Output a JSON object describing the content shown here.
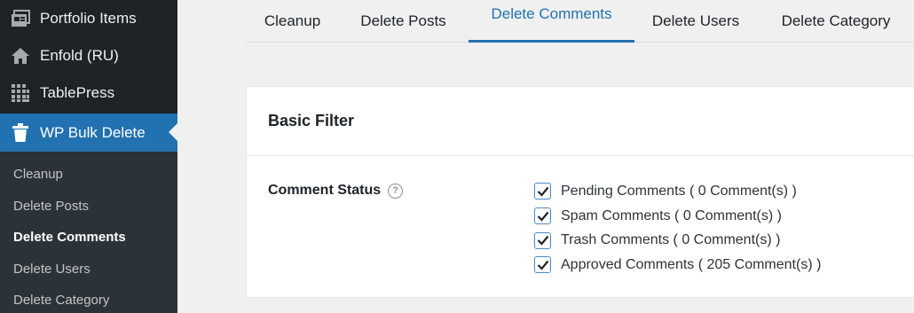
{
  "sidebar": {
    "menu": [
      {
        "label": "Portfolio Items",
        "icon": "portfolio-icon"
      },
      {
        "label": "Enfold (RU)",
        "icon": "home-icon"
      },
      {
        "label": "TablePress",
        "icon": "table-icon"
      },
      {
        "label": "WP Bulk Delete",
        "icon": "trash-icon",
        "current": true
      }
    ],
    "submenu": [
      {
        "label": "Cleanup"
      },
      {
        "label": "Delete Posts"
      },
      {
        "label": "Delete Comments",
        "active": true
      },
      {
        "label": "Delete Users"
      },
      {
        "label": "Delete Category"
      }
    ]
  },
  "tabs": [
    {
      "label": "Cleanup"
    },
    {
      "label": "Delete Posts"
    },
    {
      "label": "Delete Comments",
      "active": true
    },
    {
      "label": "Delete Users"
    },
    {
      "label": "Delete Category"
    }
  ],
  "card": {
    "title": "Basic Filter",
    "field_label": "Comment Status",
    "help_icon": "help-icon",
    "options": [
      {
        "label": "Pending Comments ( 0 Comment(s) )",
        "checked": true
      },
      {
        "label": "Spam Comments ( 0 Comment(s) )",
        "checked": true
      },
      {
        "label": "Trash Comments ( 0 Comment(s) )",
        "checked": true
      },
      {
        "label": "Approved Comments ( 205 Comment(s) )",
        "checked": true
      }
    ]
  },
  "colors": {
    "sidebar_bg": "#1d2327",
    "submenu_bg": "#2c3338",
    "accent": "#2271b1",
    "page_bg": "#f0f0f1"
  }
}
